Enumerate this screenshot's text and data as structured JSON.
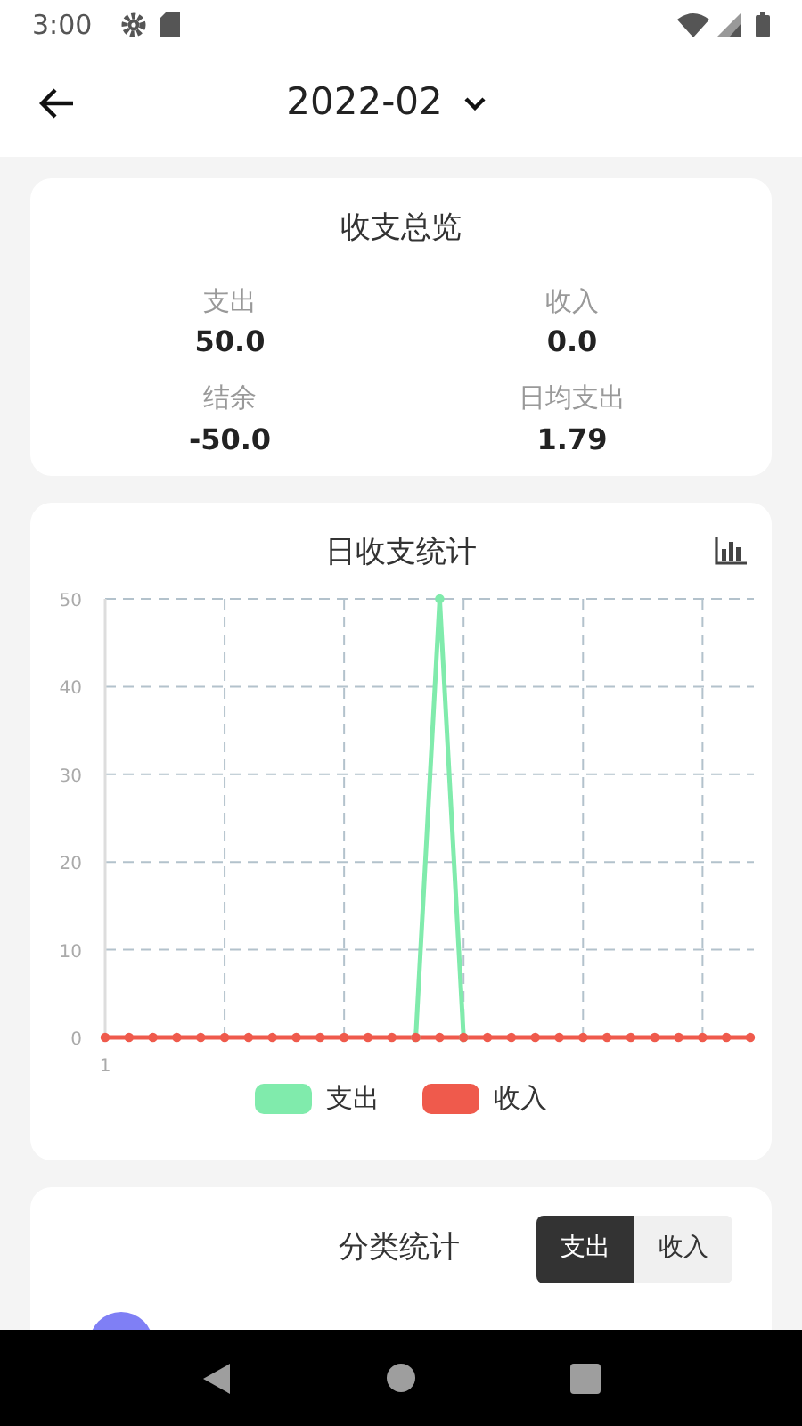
{
  "status_bar": {
    "time": "3:00"
  },
  "header": {
    "title": "2022-02"
  },
  "overview": {
    "title": "收支总览",
    "items": [
      {
        "label": "支出",
        "value": "50.0"
      },
      {
        "label": "收入",
        "value": "0.0"
      },
      {
        "label": "结余",
        "value": "-50.0"
      },
      {
        "label": "日均支出",
        "value": "1.79"
      }
    ]
  },
  "daily": {
    "title": "日收支统计",
    "chart_data": {
      "type": "line",
      "categories": [
        "1",
        null,
        null,
        null,
        null,
        null,
        null,
        null,
        null,
        null,
        null,
        null,
        null,
        null,
        null,
        null,
        null,
        null,
        null,
        null,
        null,
        null,
        null,
        null,
        null,
        null,
        null,
        null
      ],
      "grid": true,
      "ylim": [
        0,
        50
      ],
      "yticks": [
        {
          "value": 0,
          "label": "0"
        },
        {
          "value": 10,
          "label": "10"
        },
        {
          "value": 20,
          "label": "20"
        },
        {
          "value": 30,
          "label": "30"
        },
        {
          "value": 40,
          "label": "40"
        },
        {
          "value": 50,
          "label": "50"
        }
      ],
      "series": [
        {
          "name": "支出",
          "color": "#80ebac",
          "marker": true,
          "values": [
            null,
            null,
            null,
            null,
            null,
            null,
            null,
            null,
            null,
            null,
            null,
            null,
            null,
            0,
            50,
            0,
            null,
            null,
            null,
            null,
            null,
            null,
            null,
            null,
            null,
            null,
            null,
            null
          ]
        },
        {
          "name": "收入",
          "color": "#ef5a4c",
          "marker": true,
          "values": [
            0,
            0,
            0,
            0,
            0,
            0,
            0,
            0,
            0,
            0,
            0,
            0,
            0,
            0,
            0,
            0,
            0,
            0,
            0,
            0,
            0,
            0,
            0,
            0,
            0,
            0,
            0,
            0
          ]
        }
      ]
    }
  },
  "category": {
    "title": "分类统计",
    "tabs": [
      {
        "label": "支出",
        "selected": true
      },
      {
        "label": "收入",
        "selected": false
      }
    ]
  }
}
